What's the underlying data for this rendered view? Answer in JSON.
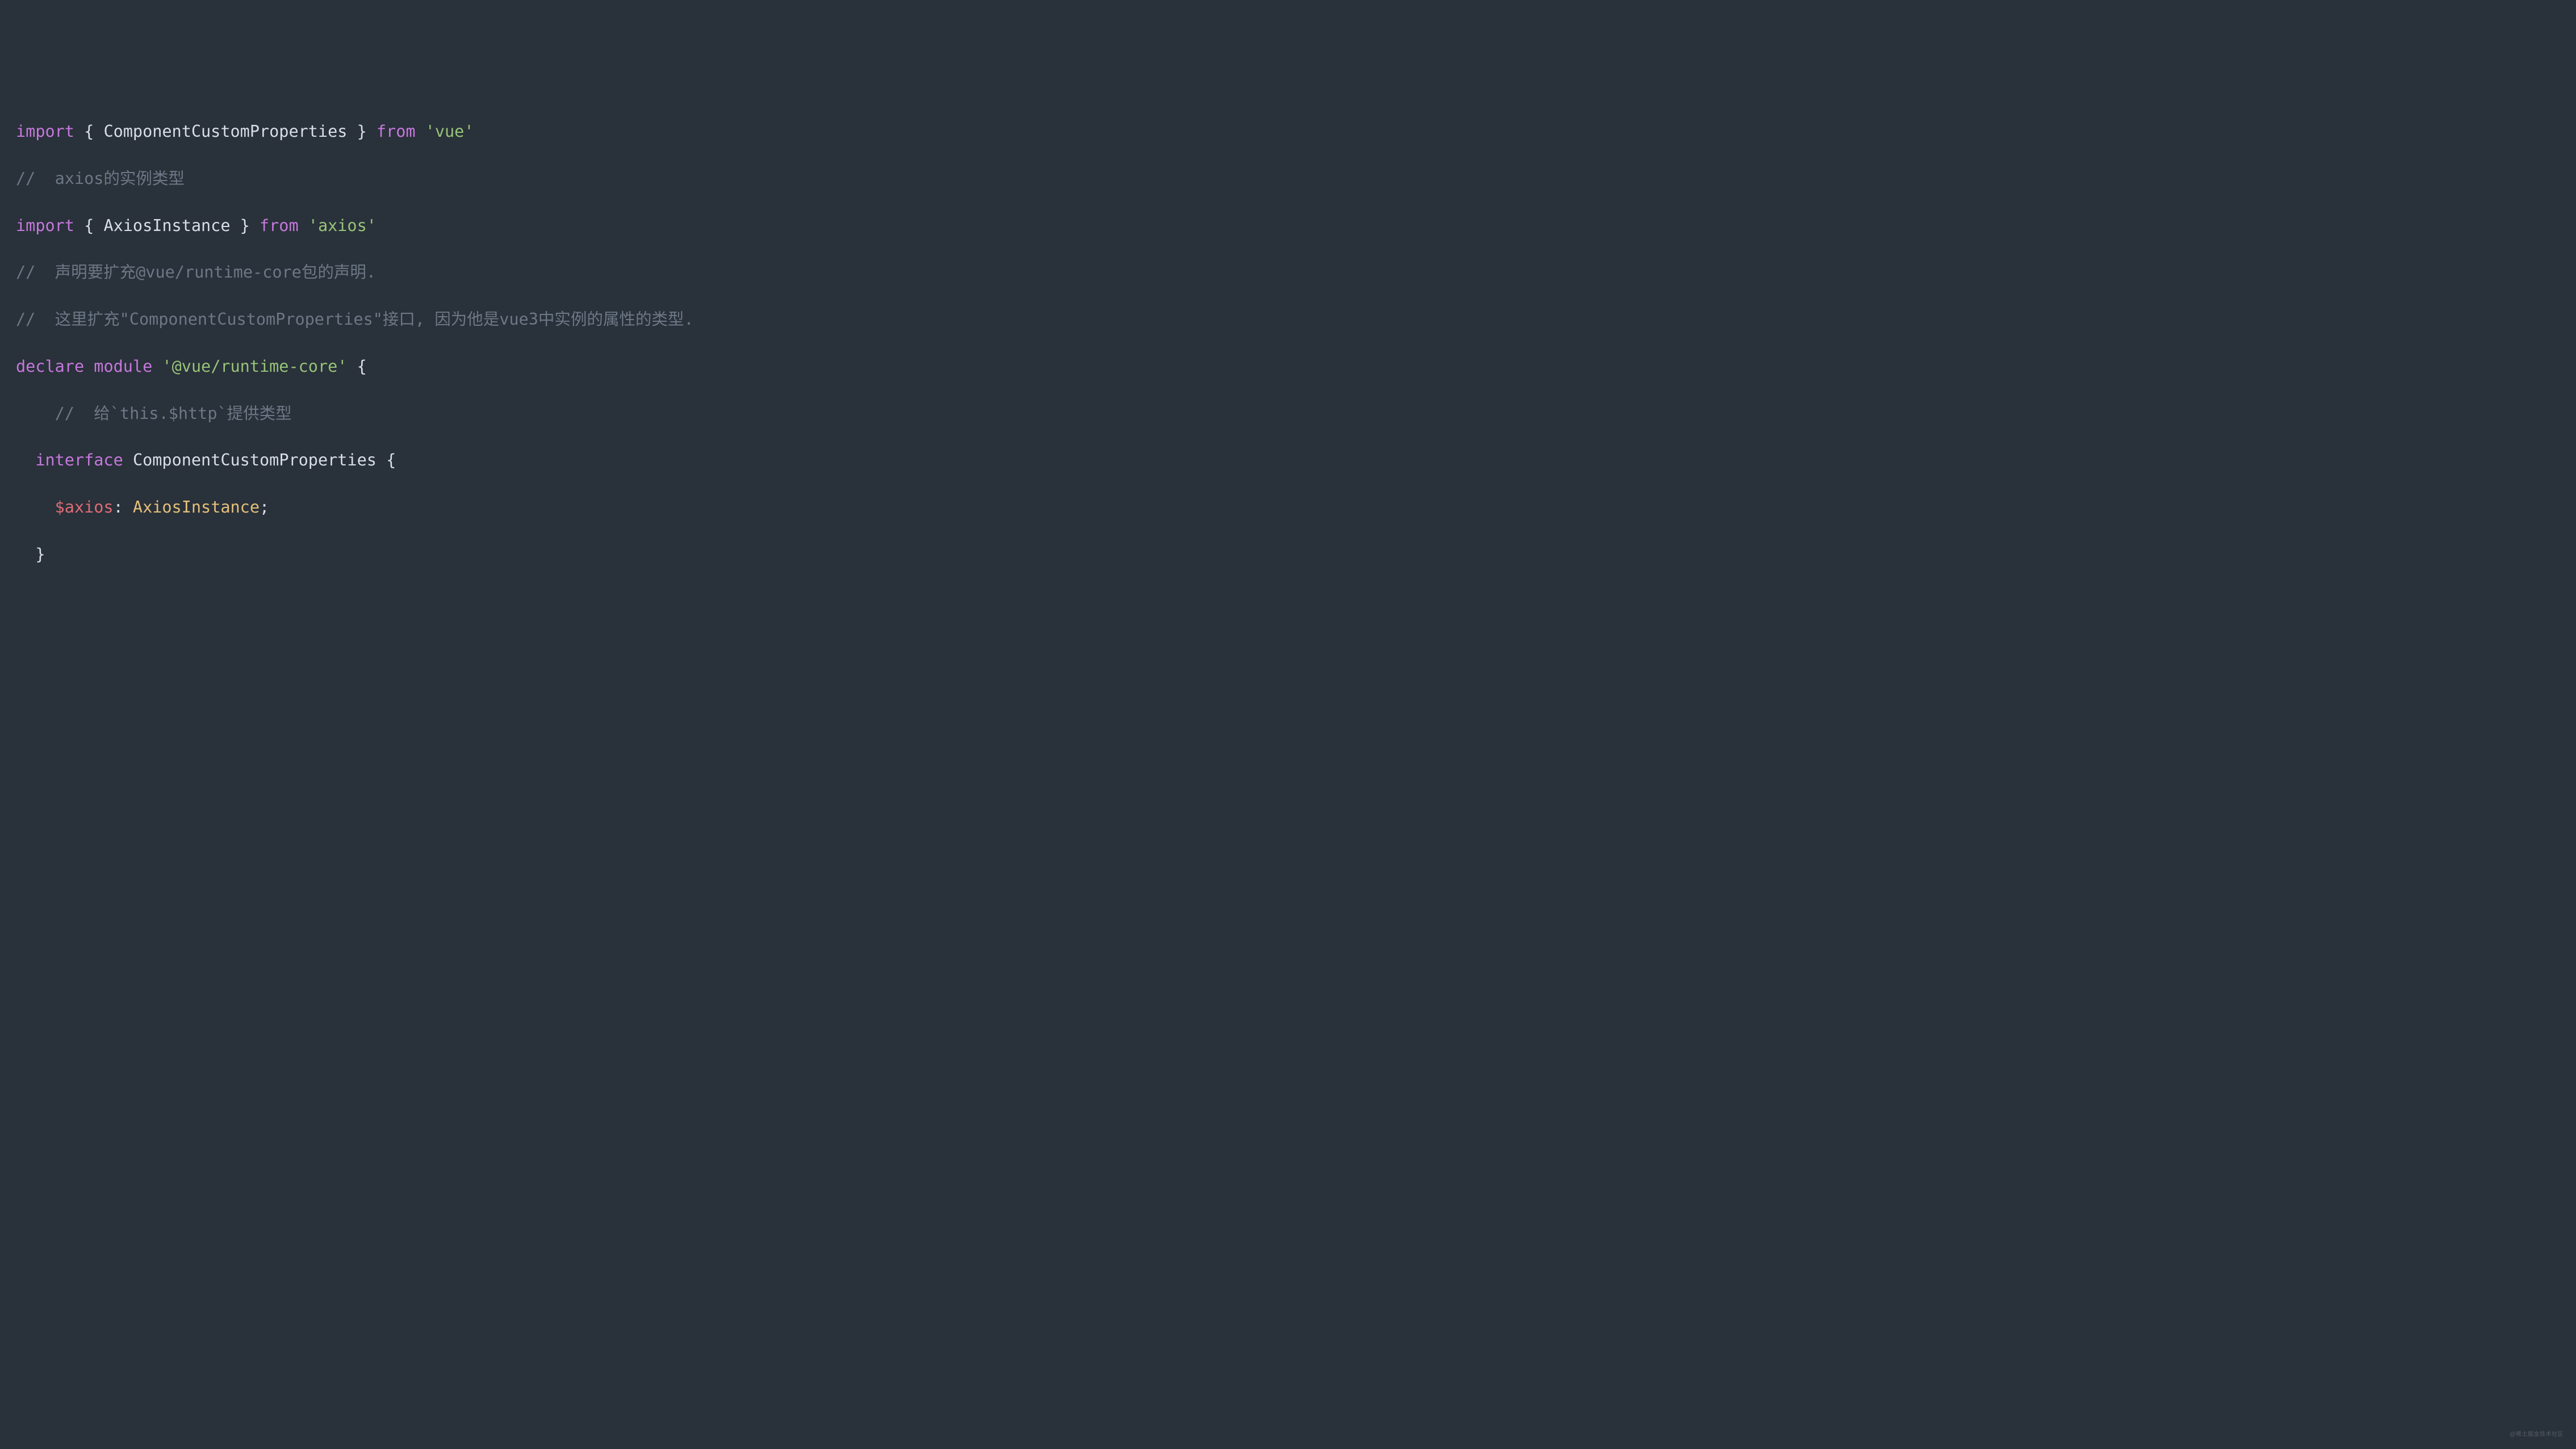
{
  "lines": {
    "l1": {
      "import": "import",
      "braceL": " { ",
      "ident": "ComponentCustomProperties",
      "braceR": " } ",
      "from": "from",
      "sp": " ",
      "str": "'vue'"
    },
    "l2": {
      "comment": "//  axios的实例类型"
    },
    "l3": {
      "import": "import",
      "braceL": " { ",
      "ident": "AxiosInstance",
      "braceR": " } ",
      "from": "from",
      "sp": " ",
      "str": "'axios'"
    },
    "l4": {
      "comment": "//  声明要扩充@vue/runtime-core包的声明."
    },
    "l5": {
      "comment": "//  这里扩充\"ComponentCustomProperties\"接口, 因为他是vue3中实例的属性的类型."
    },
    "l6": {
      "declare": "declare",
      "sp1": " ",
      "module": "module",
      "sp2": " ",
      "str": "'@vue/runtime-core'",
      "sp3": " ",
      "brace": "{"
    },
    "l7": {
      "indent": "    ",
      "comment": "//  给`this.$http`提供类型"
    },
    "l8": {
      "indent": "  ",
      "interface": "interface",
      "sp": " ",
      "ident": "ComponentCustomProperties",
      "sp2": " ",
      "brace": "{"
    },
    "l9": {
      "indent": "    ",
      "field": "$axios",
      "colon": ": ",
      "type": "AxiosInstance",
      "semi": ";"
    },
    "l10": {
      "indent": "  ",
      "brace": "}"
    }
  },
  "watermark": "@稀土掘金技术社区"
}
